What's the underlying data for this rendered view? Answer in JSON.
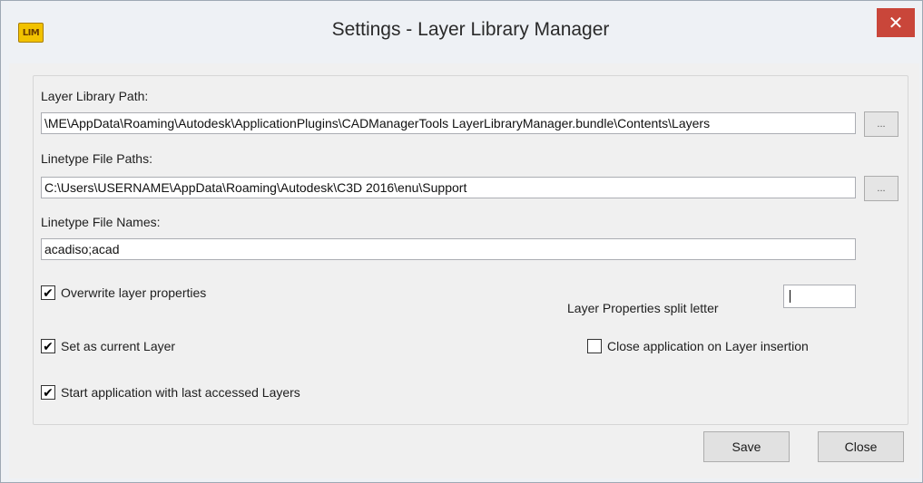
{
  "window": {
    "app_icon_text": "LIM",
    "title": "Settings - Layer Library Manager",
    "close_glyph": "✕"
  },
  "fields": {
    "layer_library_path": {
      "label": "Layer Library Path:",
      "value": "\\ME\\AppData\\Roaming\\Autodesk\\ApplicationPlugins\\CADManagerTools LayerLibraryManager.bundle\\Contents\\Layers",
      "browse_label": "..."
    },
    "linetype_file_paths": {
      "label": "Linetype File Paths:",
      "value": "C:\\Users\\USERNAME\\AppData\\Roaming\\Autodesk\\C3D 2016\\enu\\Support",
      "browse_label": "..."
    },
    "linetype_file_names": {
      "label": "Linetype File Names:",
      "value": "acadiso;acad"
    }
  },
  "options": {
    "overwrite_layer_properties": {
      "label": "Overwrite layer properties",
      "checked": true
    },
    "set_as_current_layer": {
      "label": "Set as current Layer",
      "checked": true
    },
    "start_with_last_layers": {
      "label": "Start application with last accessed Layers",
      "checked": true
    },
    "close_on_insertion": {
      "label": "Close application on Layer insertion",
      "checked": false
    },
    "split_letter": {
      "label": "Layer Properties split letter",
      "value": ""
    }
  },
  "buttons": {
    "save": "Save",
    "close": "Close"
  },
  "glyphs": {
    "checked": "✔",
    "unchecked": ""
  },
  "colors": {
    "close_button": "#c9463a",
    "app_icon": "#f2c200"
  }
}
